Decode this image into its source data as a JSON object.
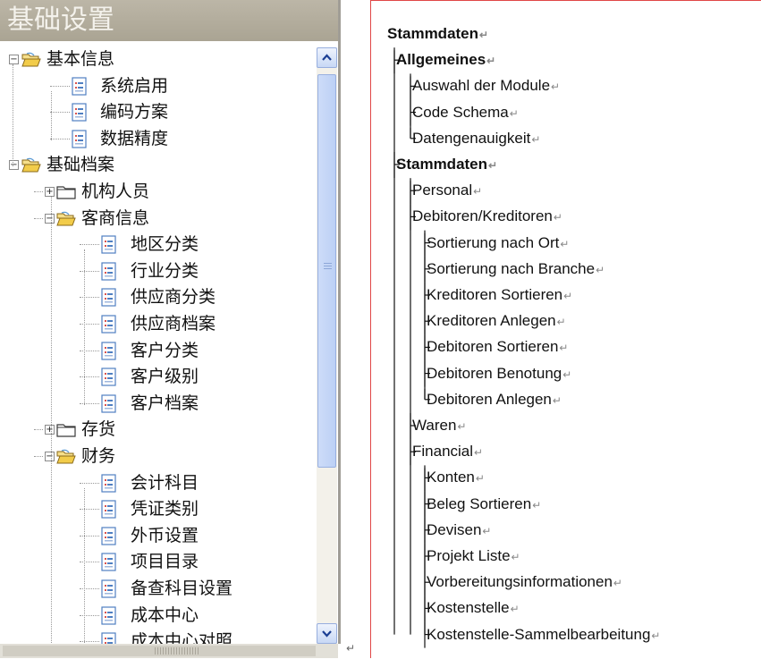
{
  "left_panel": {
    "title": "基础设置",
    "tree": [
      {
        "label": "基本信息",
        "type": "folder-open",
        "expander": "−",
        "level": 0
      },
      {
        "label": "系统启用",
        "type": "doc",
        "level": 1
      },
      {
        "label": "编码方案",
        "type": "doc",
        "level": 1
      },
      {
        "label": "数据精度",
        "type": "doc",
        "level": 1
      },
      {
        "label": "基础档案",
        "type": "folder-open",
        "expander": "−",
        "level": 0
      },
      {
        "label": "机构人员",
        "type": "folder-closed",
        "expander": "+",
        "level": 1
      },
      {
        "label": "客商信息",
        "type": "folder-open",
        "expander": "−",
        "level": 1
      },
      {
        "label": "地区分类",
        "type": "doc",
        "level": 2
      },
      {
        "label": "行业分类",
        "type": "doc",
        "level": 2
      },
      {
        "label": "供应商分类",
        "type": "doc",
        "level": 2
      },
      {
        "label": "供应商档案",
        "type": "doc",
        "level": 2
      },
      {
        "label": "客户分类",
        "type": "doc",
        "level": 2
      },
      {
        "label": "客户级别",
        "type": "doc",
        "level": 2
      },
      {
        "label": "客户档案",
        "type": "doc",
        "level": 2
      },
      {
        "label": "存货",
        "type": "folder-closed",
        "expander": "+",
        "level": 1
      },
      {
        "label": "财务",
        "type": "folder-open",
        "expander": "−",
        "level": 1
      },
      {
        "label": "会计科目",
        "type": "doc",
        "level": 2
      },
      {
        "label": "凭证类别",
        "type": "doc",
        "level": 2
      },
      {
        "label": "外币设置",
        "type": "doc",
        "level": 2
      },
      {
        "label": "项目目录",
        "type": "doc",
        "level": 2
      },
      {
        "label": "备查科目设置",
        "type": "doc",
        "level": 2
      },
      {
        "label": "成本中心",
        "type": "doc",
        "level": 2
      },
      {
        "label": "成本中心对照",
        "type": "doc",
        "level": 2
      }
    ],
    "icons": {
      "scroll_up": "arrow-up-icon",
      "scroll_down": "arrow-down-icon"
    },
    "colors": {
      "title_bg": "#aaa493",
      "scroll_thumb": "#c5d6f6",
      "folder": "#e8c24c"
    }
  },
  "right_panel": {
    "items": [
      {
        "text": "Stammdaten",
        "level": 0,
        "bold": true,
        "last": false
      },
      {
        "text": "Allgemeines",
        "level": 1,
        "bold": true,
        "last": false
      },
      {
        "text": "Auswahl der Module",
        "level": 2,
        "bold": false,
        "last": false
      },
      {
        "text": "Code Schema",
        "level": 2,
        "bold": false,
        "last": false
      },
      {
        "text": "Datengenauigkeit",
        "level": 2,
        "bold": false,
        "last": true
      },
      {
        "text": "Stammdaten",
        "level": 1,
        "bold": true,
        "last": false
      },
      {
        "text": "Personal",
        "level": 2,
        "bold": false,
        "last": false
      },
      {
        "text": "Debitoren/Kreditoren",
        "level": 2,
        "bold": false,
        "last": false
      },
      {
        "text": "Sortierung nach Ort",
        "level": 3,
        "bold": false,
        "last": false
      },
      {
        "text": "Sortierung nach Branche",
        "level": 3,
        "bold": false,
        "last": false
      },
      {
        "text": "Kreditoren Sortieren",
        "level": 3,
        "bold": false,
        "last": false
      },
      {
        "text": "Kreditoren Anlegen",
        "level": 3,
        "bold": false,
        "last": false
      },
      {
        "text": "Debitoren Sortieren",
        "level": 3,
        "bold": false,
        "last": false
      },
      {
        "text": "Debitoren Benotung",
        "level": 3,
        "bold": false,
        "last": false
      },
      {
        "text": "Debitoren Anlegen",
        "level": 3,
        "bold": false,
        "last": true
      },
      {
        "text": "Waren",
        "level": 2,
        "bold": false,
        "last": false
      },
      {
        "text": "Financial",
        "level": 2,
        "bold": false,
        "last": false
      },
      {
        "text": "Konten",
        "level": 3,
        "bold": false,
        "last": false
      },
      {
        "text": "Beleg Sortieren",
        "level": 3,
        "bold": false,
        "last": false
      },
      {
        "text": "Devisen",
        "level": 3,
        "bold": false,
        "last": false
      },
      {
        "text": "Projekt Liste",
        "level": 3,
        "bold": false,
        "last": false
      },
      {
        "text": "Vorbereitungsinformationen",
        "level": 3,
        "bold": false,
        "last": false
      },
      {
        "text": "Kostenstelle",
        "level": 3,
        "bold": false,
        "last": false
      },
      {
        "text": "Kostenstelle-Sammelbearbeitung",
        "level": 3,
        "bold": false,
        "last": false
      }
    ],
    "paragraph_mark": "↵",
    "colors": {
      "border": "#e04646"
    }
  }
}
